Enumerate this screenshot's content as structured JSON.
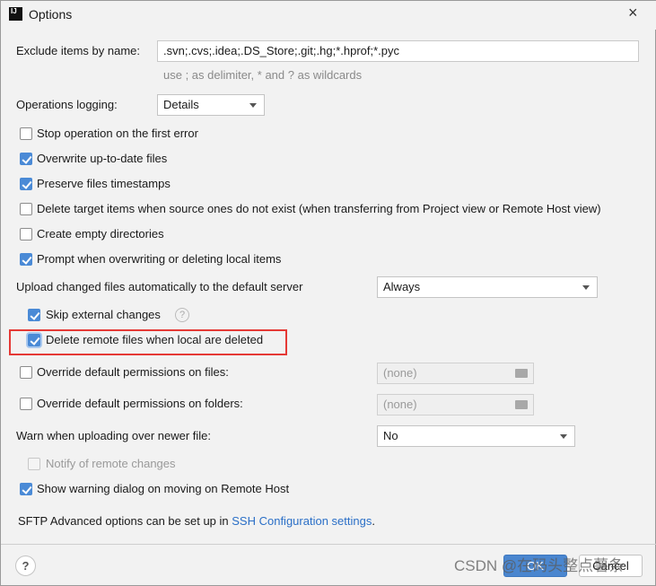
{
  "window": {
    "title": "Options",
    "close": "×"
  },
  "exclude": {
    "label": "Exclude items by name:",
    "value": ".svn;.cvs;.idea;.DS_Store;.git;.hg;*.hprof;*.pyc",
    "hint": "use ; as delimiter, * and ? as wildcards"
  },
  "logging": {
    "label": "Operations logging:",
    "value": "Details"
  },
  "checks": [
    {
      "label": "Stop operation on the first error",
      "checked": false
    },
    {
      "label": "Overwrite up-to-date files",
      "checked": true
    },
    {
      "label": "Preserve files timestamps",
      "checked": true
    },
    {
      "label": "Delete target items when source ones do not exist (when transferring from Project view or Remote Host view)",
      "checked": false
    },
    {
      "label": "Create empty directories",
      "checked": false
    },
    {
      "label": "Prompt when overwriting or deleting local items",
      "checked": true
    }
  ],
  "upload": {
    "label": "Upload changed files automatically to the default server",
    "value": "Always",
    "skip": {
      "label": "Skip external changes",
      "checked": true
    },
    "delete_remote": {
      "label": "Delete remote files when local are deleted",
      "checked": true
    }
  },
  "perm_files": {
    "label": "Override default permissions on files:",
    "value": "(none)",
    "checked": false
  },
  "perm_folders": {
    "label": "Override default permissions on folders:",
    "value": "(none)",
    "checked": false
  },
  "warn": {
    "label": "Warn when uploading over newer file:",
    "value": "No"
  },
  "notify": {
    "label": "Notify of remote changes",
    "checked": false,
    "disabled": true
  },
  "show_warning": {
    "label": "Show warning dialog on moving on Remote Host",
    "checked": true
  },
  "sftp": {
    "text": "SFTP Advanced options can be set up in ",
    "link": "SSH Configuration settings",
    "end": "."
  },
  "footer": {
    "help": "?",
    "ok": "OK",
    "cancel": "Cancel",
    "watermark": "CSDN @在码头整点薯条"
  },
  "colors": {
    "accent": "#4a8ad6",
    "highlight": "#e53935",
    "link": "#2b6fc7"
  }
}
